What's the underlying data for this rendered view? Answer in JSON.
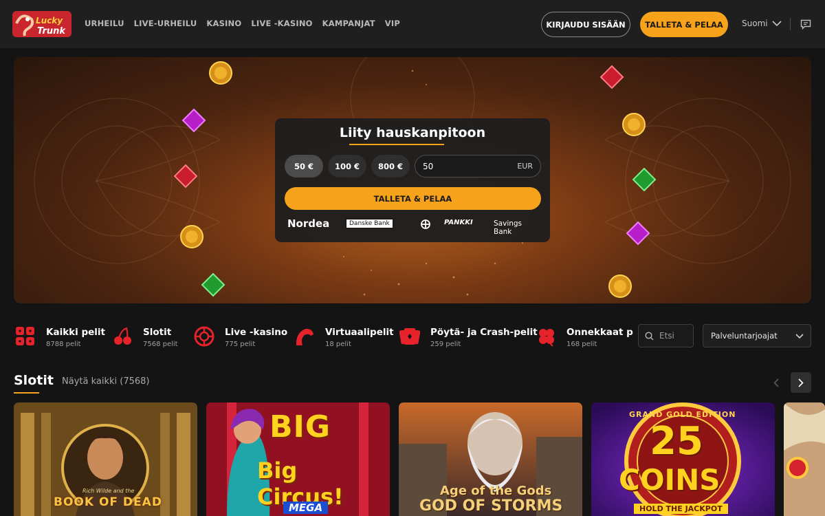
{
  "header": {
    "logo_text": "Lucky Trunk",
    "nav": [
      "URHEILU",
      "LIVE-URHEILU",
      "KASINO",
      "LIVE -KASINO",
      "KAMPANJAT",
      "VIP"
    ],
    "login_label": "KIRJAUDU SISÄÄN",
    "deposit_label": "TALLETA & PELAA",
    "language": "Suomi"
  },
  "hero": {
    "title": "Liity hauskanpitoon",
    "chips": [
      "50 €",
      "100 €",
      "800 €"
    ],
    "selected_chip": "50 €",
    "amount_value": "50",
    "currency": "EUR",
    "cta_label": "TALLETA & PELAA",
    "banks": [
      "Nordea",
      "Danske Bank",
      "",
      "PANKKI",
      "Savings Bank"
    ]
  },
  "categories": [
    {
      "name": "Kaikki pelit",
      "count": "8788 pelit",
      "icon": "dice-icon"
    },
    {
      "name": "Slotit",
      "count": "7568 pelit",
      "icon": "cherry-icon"
    },
    {
      "name": "Live -kasino",
      "count": "775 pelit",
      "icon": "roulette-icon"
    },
    {
      "name": "Virtuaalipelit",
      "count": "18 pelit",
      "icon": "horse-icon"
    },
    {
      "name": "Pöytä- ja Crash-pelit",
      "count": "259 pelit",
      "icon": "cards-icon"
    },
    {
      "name": "Onnekkaat p",
      "count": "168 pelit",
      "icon": "clover-icon"
    }
  ],
  "search_placeholder": "Etsi",
  "providers_label": "Palveluntarjoajat",
  "section": {
    "title": "Slotit",
    "view_all": "Näytä kaikki (7568)"
  },
  "games": [
    {
      "name": "Book of Dead",
      "subtitle": "Rich Wilde and the"
    },
    {
      "name": "Big Circus!",
      "subtitle": "MEGA"
    },
    {
      "name": "Age of the Gods",
      "subtitle": "God of Storms"
    },
    {
      "name": "25 Coins",
      "subtitle": "Hold the Jackpot"
    }
  ],
  "colors": {
    "accent": "#f7a21b",
    "header_bg": "#1f1f1f",
    "page_bg": "#141414"
  }
}
